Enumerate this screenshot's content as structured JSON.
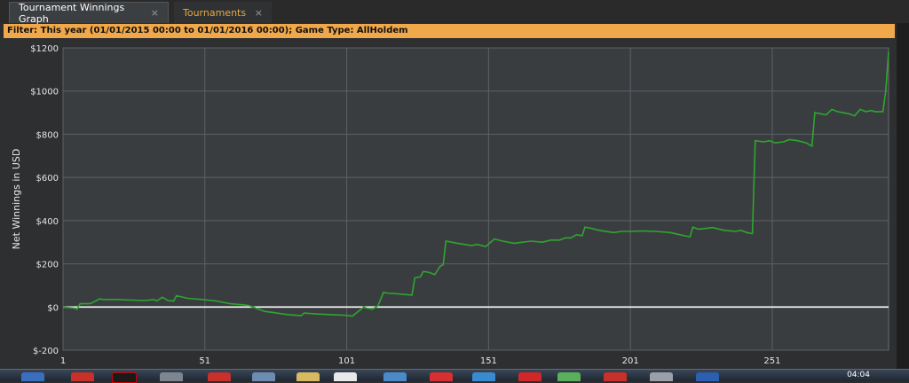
{
  "tabs": [
    {
      "label": "Tournament Winnings Graph",
      "close": "×"
    },
    {
      "label": "Tournaments",
      "close": "×"
    }
  ],
  "filter_text": "Filter:  This year (01/01/2015 00:00 to 01/01/2016 00:00); Game Type: AllHoldem",
  "colors": {
    "line": "#2fa52f",
    "zero_line": "#ffffff",
    "plot_bg": "#3a3d40",
    "grid": "#5d6064",
    "filter_bg": "#f0a84a"
  },
  "chart_data": {
    "type": "line",
    "ylabel": "Net Winnings in USD",
    "xlabel": "",
    "ylim": [
      -200,
      1200
    ],
    "xlim": [
      1,
      292
    ],
    "yticks": [
      -200,
      0,
      200,
      400,
      600,
      800,
      1000,
      1200
    ],
    "ytick_labels": [
      "$-200",
      "$0",
      "$200",
      "$400",
      "$600",
      "$800",
      "$1000",
      "$1200"
    ],
    "xticks": [
      1,
      51,
      101,
      151,
      201,
      251
    ],
    "xtick_labels": [
      "1",
      "51",
      "101",
      "151",
      "201",
      "251"
    ],
    "grid": true,
    "series": [
      {
        "x": [
          1,
          5,
          6,
          7,
          10,
          11,
          14,
          15,
          20,
          25,
          30,
          33,
          34,
          36,
          38,
          40,
          41,
          45,
          50,
          55,
          58,
          60,
          63,
          66,
          68,
          70,
          72,
          75,
          80,
          85,
          86,
          90,
          95,
          100,
          103,
          107,
          108,
          110,
          112,
          114,
          115,
          120,
          124,
          125,
          127,
          128,
          130,
          131,
          132,
          134,
          135,
          136,
          140,
          145,
          147,
          150,
          153,
          156,
          160,
          163,
          166,
          170,
          173,
          176,
          178,
          180,
          182,
          184,
          185,
          187,
          190,
          195,
          198,
          201,
          205,
          210,
          215,
          220,
          222,
          223,
          225,
          228,
          230,
          234,
          238,
          240,
          242,
          244,
          245,
          248,
          250,
          252,
          255,
          257,
          260,
          263,
          265,
          266,
          270,
          272,
          274,
          278,
          280,
          282,
          284,
          286,
          287,
          290,
          291,
          292
        ],
        "values": [
          0,
          -5,
          -10,
          15,
          15,
          18,
          38,
          35,
          35,
          32,
          30,
          35,
          28,
          45,
          30,
          28,
          52,
          40,
          35,
          28,
          20,
          15,
          12,
          8,
          0,
          -10,
          -20,
          -25,
          -35,
          -40,
          -28,
          -32,
          -35,
          -38,
          -42,
          0,
          -5,
          -10,
          5,
          68,
          65,
          60,
          55,
          135,
          140,
          165,
          160,
          155,
          150,
          190,
          195,
          305,
          295,
          285,
          290,
          280,
          315,
          305,
          295,
          300,
          305,
          300,
          310,
          310,
          320,
          320,
          335,
          330,
          370,
          365,
          355,
          345,
          350,
          350,
          352,
          350,
          345,
          330,
          325,
          370,
          360,
          365,
          368,
          355,
          350,
          355,
          345,
          340,
          770,
          765,
          770,
          760,
          765,
          775,
          770,
          760,
          745,
          900,
          890,
          915,
          905,
          895,
          885,
          915,
          905,
          910,
          905,
          905,
          1000,
          1180
        ]
      }
    ]
  },
  "taskbar": {
    "clock": "04:04"
  }
}
